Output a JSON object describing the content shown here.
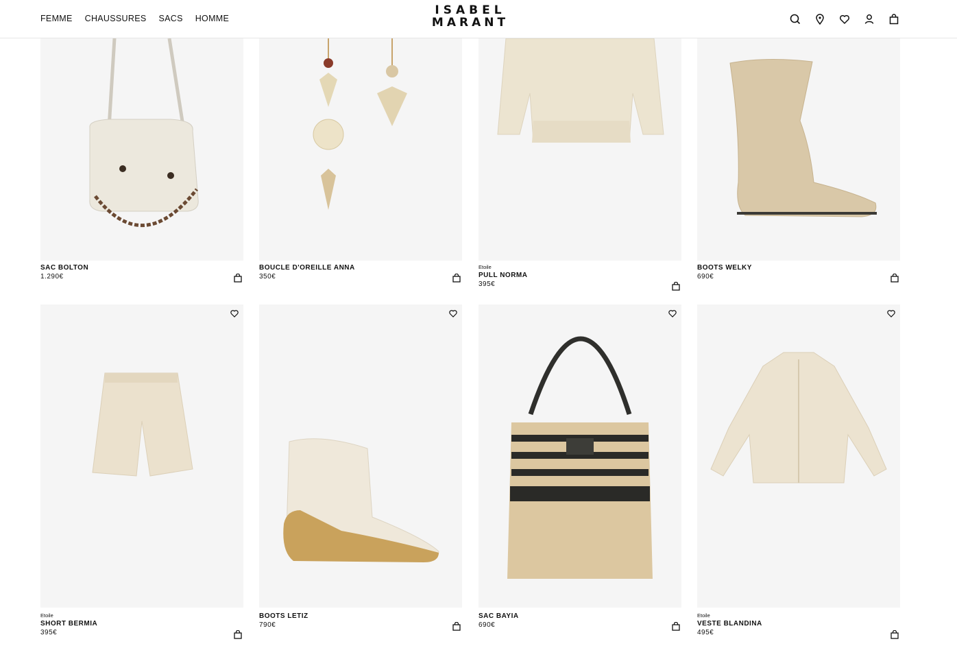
{
  "brand": {
    "line1": "ISABEL",
    "line2": "MARANT"
  },
  "nav": [
    "FEMME",
    "CHAUSSURES",
    "SACS",
    "HOMME"
  ],
  "header_icons": [
    "search-icon",
    "store-locator-icon",
    "wishlist-icon",
    "account-icon",
    "cart-icon"
  ],
  "products": [
    {
      "collection": "",
      "name": "SAC BOLTON",
      "price": "1.290€"
    },
    {
      "collection": "",
      "name": "BOUCLE D'OREILLE ANNA",
      "price": "350€"
    },
    {
      "collection": "Etoile",
      "name": "PULL NORMA",
      "price": "395€"
    },
    {
      "collection": "",
      "name": "BOOTS WELKY",
      "price": "690€"
    },
    {
      "collection": "Etoile",
      "name": "SHORT BERMIA",
      "price": "395€"
    },
    {
      "collection": "",
      "name": "BOOTS LETIZ",
      "price": "790€"
    },
    {
      "collection": "",
      "name": "SAC BAYIA",
      "price": "690€"
    },
    {
      "collection": "Etoile",
      "name": "VESTE BLANDINA",
      "price": "495€"
    }
  ],
  "colors": {
    "card_background": "#f5f5f5",
    "text": "#111111"
  }
}
